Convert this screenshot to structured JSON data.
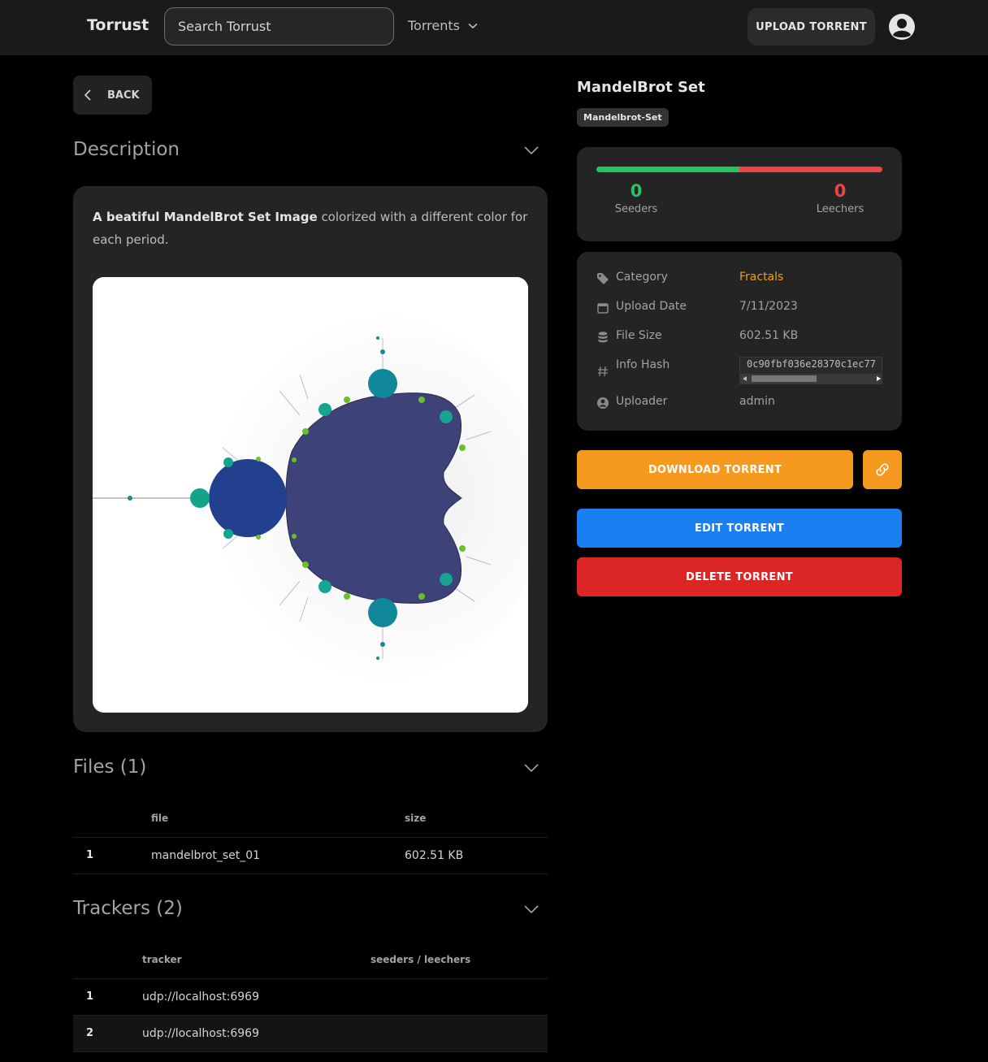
{
  "header": {
    "brand": "Torrust",
    "search_placeholder": "Search Torrust",
    "torrents_menu": "Torrents",
    "upload_label": "UPLOAD TORRENT"
  },
  "back_label": "BACK",
  "description": {
    "title": "Description",
    "bold_text": "A beatiful MandelBrot Set Image",
    "text": " colorized with a different color for each period."
  },
  "files": {
    "title": "Files (1)",
    "columns": [
      "file",
      "size"
    ],
    "rows": [
      {
        "index": "1",
        "file": "mandelbrot_set_01",
        "size": "602.51 KB"
      }
    ]
  },
  "trackers": {
    "title": "Trackers (2)",
    "columns": [
      "tracker",
      "seeders / leechers"
    ],
    "rows": [
      {
        "index": "1",
        "url": "udp://localhost:6969"
      },
      {
        "index": "2",
        "url": "udp://localhost:6969"
      }
    ]
  },
  "torrent": {
    "title": "MandelBrot Set",
    "tag": "Mandelbrot-Set",
    "seeders": "0",
    "seeders_label": "Seeders",
    "leechers": "0",
    "leechers_label": "Leechers",
    "seeders_ratio": 0.5
  },
  "info": {
    "category_label": "Category",
    "category_value": "Fractals",
    "date_label": "Upload Date",
    "date_value": "7/11/2023",
    "size_label": "File Size",
    "size_value": "602.51 KB",
    "hash_label": "Info Hash",
    "hash_value": "0c90fbf036e28370c1ec77",
    "uploader_label": "Uploader",
    "uploader_value": "admin"
  },
  "actions": {
    "download": "DOWNLOAD TORRENT",
    "edit": "EDIT TORRENT",
    "delete": "DELETE TORRENT"
  },
  "colors": {
    "accent_orange": "#f59a1e",
    "edit_blue": "#1a7ff0",
    "delete_red": "#dc2626",
    "seeders_green": "#22c55e",
    "leechers_red": "#ef4444"
  }
}
